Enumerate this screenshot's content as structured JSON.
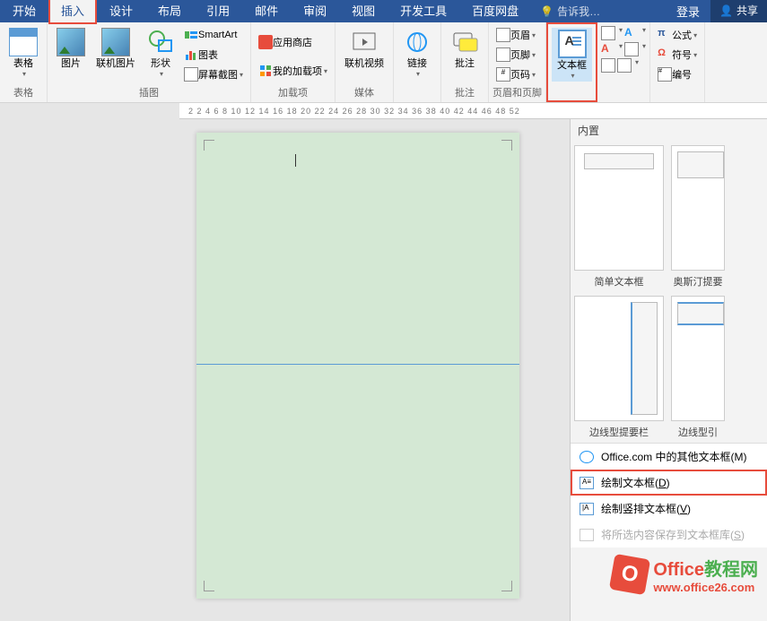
{
  "tabs": {
    "start": "开始",
    "insert": "插入",
    "design": "设计",
    "layout": "布局",
    "references": "引用",
    "mail": "邮件",
    "review": "审阅",
    "view": "视图",
    "devtools": "开发工具",
    "baidu": "百度网盘",
    "tellme": "告诉我…",
    "login": "登录",
    "share": "共享"
  },
  "ribbon": {
    "table": "表格",
    "table_group": "表格",
    "picture": "图片",
    "online_pic": "联机图片",
    "shapes": "形状",
    "smartart": "SmartArt",
    "chart": "图表",
    "screenshot": "屏幕截图",
    "illustrations_group": "插图",
    "store": "应用商店",
    "myaddins": "我的加载项",
    "addins_group": "加载项",
    "online_video": "联机视频",
    "media_group": "媒体",
    "hyperlink": "链接",
    "comment": "批注",
    "comment_group": "批注",
    "header": "页眉",
    "footer": "页脚",
    "page_number": "页码",
    "hf_group": "页眉和页脚",
    "textbox": "文本框",
    "equation": "公式",
    "symbol": "符号",
    "number": "编号"
  },
  "ruler": "2   2  4  6  8  10 12 14 16 18 20 22 24 26 28 30 32 34 36 38 40 42 44 46 48   52",
  "dropdown": {
    "builtin": "内置",
    "simple": "简单文本框",
    "austin": "奥斯汀提要",
    "border_sidebar": "边线型提要栏",
    "border_quote": "边线型引",
    "office_more": "Office.com 中的其他文本框(M)",
    "draw_textbox": "绘制文本框(D)",
    "draw_vertical": "绘制竖排文本框(V)",
    "save_selection": "将所选内容保存到文本框库(S)"
  },
  "watermark": {
    "line1a": "Office",
    "line1b": "教程网",
    "line2": "www.office26.com"
  }
}
